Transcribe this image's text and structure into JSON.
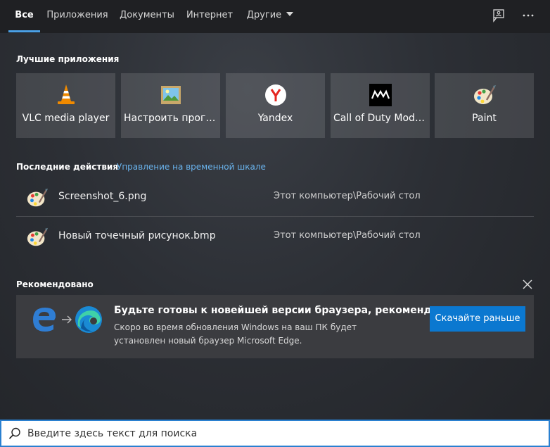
{
  "tabs": [
    {
      "label": "Все",
      "active": true
    },
    {
      "label": "Приложения"
    },
    {
      "label": "Документы"
    },
    {
      "label": "Интернет"
    },
    {
      "label": "Другие",
      "has_dropdown": true
    }
  ],
  "top_icons": [
    "feedback-icon",
    "more-options-icon"
  ],
  "top_apps": {
    "title": "Лучшие приложения",
    "items": [
      {
        "label": "VLC media player",
        "icon": "vlc-icon"
      },
      {
        "label": "Настроить прогр...",
        "icon": "picture-icon"
      },
      {
        "label": "Yandex",
        "icon": "yandex-icon"
      },
      {
        "label": "Call of Duty Mode...",
        "icon": "call-of-duty-icon"
      },
      {
        "label": "Paint",
        "icon": "paint-icon"
      }
    ]
  },
  "recent": {
    "title": "Последние действия",
    "timeline_link": "Управление на временной шкале",
    "items": [
      {
        "name": "Screenshot_6.png",
        "path": "Этот компьютер\\Рабочий стол",
        "icon": "paint-icon"
      },
      {
        "name": "Новый точечный рисунок.bmp",
        "path": "Этот компьютер\\Рабочий стол",
        "icon": "paint-icon"
      }
    ]
  },
  "recommended": {
    "title": "Рекомендовано",
    "card_title": "Будьте готовы к новейшей версии браузера, рекомендо...",
    "card_body": "Скоро во время обновления Windows на ваш ПК будет установлен новый браузер Microsoft Edge.",
    "button_label": "Скачайте раньше",
    "icons": [
      "edge-legacy-icon",
      "arrow-right-icon",
      "edge-icon",
      "close-icon"
    ]
  },
  "search": {
    "placeholder": "Введите здесь текст для поиска",
    "value": ""
  },
  "colors": {
    "accent": "#4aa0e6",
    "button": "#0b78d0",
    "link": "#6ab4ee"
  }
}
